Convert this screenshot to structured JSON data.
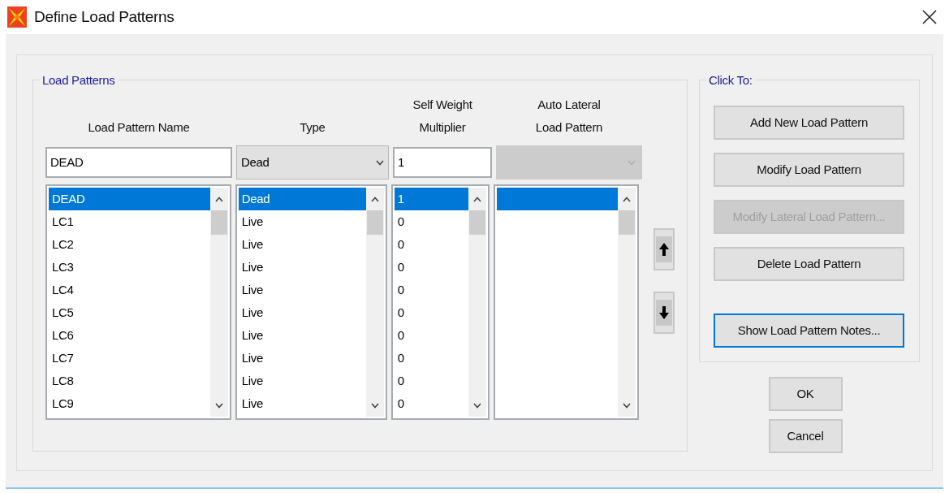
{
  "window": {
    "title": "Define Load Patterns"
  },
  "load_patterns": {
    "title": "Load Patterns",
    "columns": [
      {
        "lines": [
          "Load Pattern Name"
        ]
      },
      {
        "lines": [
          "Type"
        ]
      },
      {
        "lines": [
          "Self Weight",
          "Multiplier"
        ]
      },
      {
        "lines": [
          "Auto Lateral",
          "Load Pattern"
        ]
      }
    ],
    "inputs": {
      "name": "DEAD",
      "type": "Dead",
      "multiplier": "1",
      "auto_lateral_disabled": true
    },
    "rows": [
      {
        "name": "DEAD",
        "type": "Dead",
        "multiplier": "1",
        "selected": true
      },
      {
        "name": "LC1",
        "type": "Live",
        "multiplier": "0",
        "selected": false
      },
      {
        "name": "LC2",
        "type": "Live",
        "multiplier": "0",
        "selected": false
      },
      {
        "name": "LC3",
        "type": "Live",
        "multiplier": "0",
        "selected": false
      },
      {
        "name": "LC4",
        "type": "Live",
        "multiplier": "0",
        "selected": false
      },
      {
        "name": "LC5",
        "type": "Live",
        "multiplier": "0",
        "selected": false
      },
      {
        "name": "LC6",
        "type": "Live",
        "multiplier": "0",
        "selected": false
      },
      {
        "name": "LC7",
        "type": "Live",
        "multiplier": "0",
        "selected": false
      },
      {
        "name": "LC8",
        "type": "Live",
        "multiplier": "0",
        "selected": false
      },
      {
        "name": "LC9",
        "type": "Live",
        "multiplier": "0",
        "selected": false
      }
    ]
  },
  "click_to": {
    "title": "Click To:",
    "buttons": [
      {
        "label": "Add New Load Pattern",
        "disabled": false,
        "focused": false
      },
      {
        "label": "Modify Load Pattern",
        "disabled": false,
        "focused": false
      },
      {
        "label": "Modify Lateral Load Pattern...",
        "disabled": true,
        "focused": false
      },
      {
        "label": "Delete Load Pattern",
        "disabled": false,
        "focused": false
      },
      {
        "label": "Show Load Pattern Notes...",
        "disabled": false,
        "focused": true
      }
    ]
  },
  "dialog_buttons": [
    "OK",
    "Cancel"
  ]
}
